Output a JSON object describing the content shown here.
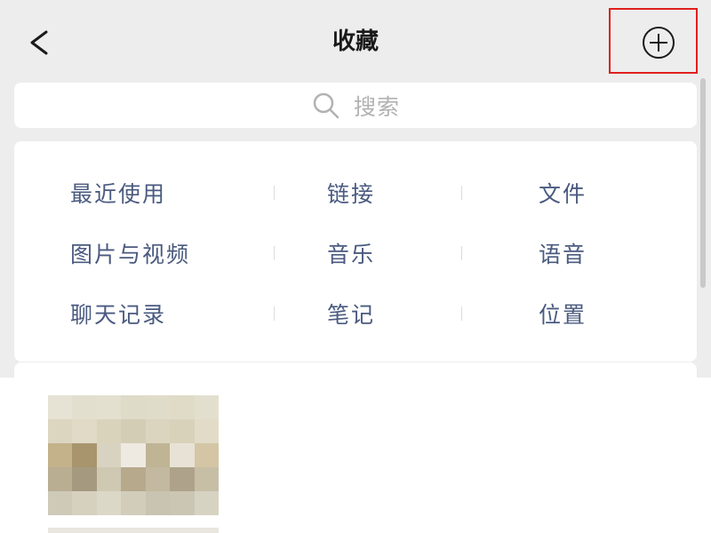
{
  "header": {
    "title": "收藏"
  },
  "search": {
    "placeholder": "搜索"
  },
  "categories": {
    "rows": [
      [
        "最近使用",
        "链接",
        "文件"
      ],
      [
        "图片与视频",
        "音乐",
        "语音"
      ],
      [
        "聊天记录",
        "笔记",
        "位置"
      ]
    ]
  },
  "colors": {
    "background": "#ededed",
    "card": "#ffffff",
    "category_text": "#4a5a7f",
    "highlight": "#e0201b"
  },
  "thumbnail_colors": [
    [
      "#e6e3d5",
      "#e2dfcf",
      "#e4e0d0",
      "#dedbc9",
      "#e0dcca",
      "#dfdbc7",
      "#e3dfcf"
    ],
    [
      "#dcd6c1",
      "#e0dac6",
      "#dad3bc",
      "#d4cdb6",
      "#dbd4be",
      "#d9d2ba",
      "#e1dbc8"
    ],
    [
      "#c4b28a",
      "#a8956d",
      "#d8d2c0",
      "#eeeae2",
      "#bfb494",
      "#e8e2d6",
      "#d4c6a4"
    ],
    [
      "#b9ad92",
      "#a59a7f",
      "#cfc8b3",
      "#b6a98c",
      "#c3b9a0",
      "#aea38a",
      "#c7bea6"
    ],
    [
      "#cfcab8",
      "#d6d1bf",
      "#dcd8c8",
      "#d2cdbb",
      "#c9c4b1",
      "#cbc6b3",
      "#d7d3c3"
    ]
  ]
}
